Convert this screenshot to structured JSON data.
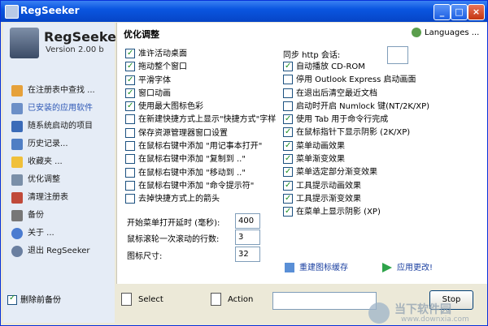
{
  "window": {
    "title": "RegSeeker"
  },
  "sidebar": {
    "app_name": "RegSeeker",
    "version": "Version 2.00 b",
    "items": [
      {
        "label": "在注册表中查找 ..."
      },
      {
        "label": "已安装的应用软件"
      },
      {
        "label": "随系统启动的项目"
      },
      {
        "label": "历史记录..."
      },
      {
        "label": "收藏夹 ..."
      },
      {
        "label": "优化调整"
      },
      {
        "label": "清理注册表"
      },
      {
        "label": "备份"
      },
      {
        "label": "关于 ..."
      },
      {
        "label": "退出 RegSeeker"
      }
    ],
    "delete_backup": {
      "label": "删除前备份",
      "checked": true
    }
  },
  "panel": {
    "title": "优化调整",
    "languages_label": "Languages ...",
    "http_label": "同步 http 会话:",
    "left_options": [
      {
        "label": "准许活动桌面",
        "checked": true
      },
      {
        "label": "拖动整个窗口",
        "checked": true
      },
      {
        "label": "平滑字体",
        "checked": true
      },
      {
        "label": "窗口动画",
        "checked": true
      },
      {
        "label": "使用最大图标色彩",
        "checked": true
      },
      {
        "label": "在新建快捷方式上显示\"快捷方式\"字样",
        "checked": false
      },
      {
        "label": "保存资源管理器窗口设置",
        "checked": false
      },
      {
        "label": "在鼠标右键中添加 \"用记事本打开\"",
        "checked": false
      },
      {
        "label": "在鼠标右键中添加 \"复制到 ..\"",
        "checked": false
      },
      {
        "label": "在鼠标右键中添加 \"移动到 ..\"",
        "checked": false
      },
      {
        "label": "在鼠标右键中添加 \"命令提示符\"",
        "checked": false
      },
      {
        "label": "去掉快捷方式上的箭头",
        "checked": false
      }
    ],
    "right_options": [
      {
        "label": "自动播放 CD-ROM",
        "checked": true
      },
      {
        "label": "停用 Outlook Express 启动画面",
        "checked": false
      },
      {
        "label": "在退出后清空最近文档",
        "checked": false
      },
      {
        "label": "启动时开启 Numlock 键(NT/2K/XP)",
        "checked": false
      },
      {
        "label": "使用 Tab 用于命令行完成",
        "checked": true
      },
      {
        "label": "在鼠标指针下显示阴影 (2K/XP)",
        "checked": true
      },
      {
        "label": "菜单动画效果",
        "checked": true
      },
      {
        "label": "菜单渐变效果",
        "checked": true
      },
      {
        "label": "菜单选定部分渐变效果",
        "checked": true
      },
      {
        "label": "工具提示动画效果",
        "checked": true
      },
      {
        "label": "工具提示渐变效果",
        "checked": true
      },
      {
        "label": "在菜单上显示阴影 (XP)",
        "checked": true
      }
    ],
    "fields": [
      {
        "label": "开始菜单打开延时 (毫秒):",
        "value": "400"
      },
      {
        "label": "鼠标滚轮一次滚动的行数:",
        "value": "3"
      },
      {
        "label": "图标尺寸:",
        "value": "32"
      }
    ],
    "rebuild_icon_cache": "重建图标缓存",
    "apply_changes": "应用更改!"
  },
  "bottom": {
    "select": "Select",
    "action": "Action",
    "stop": "Stop"
  },
  "watermark": {
    "title": "当下软件园",
    "url": "www.downxia.com"
  }
}
